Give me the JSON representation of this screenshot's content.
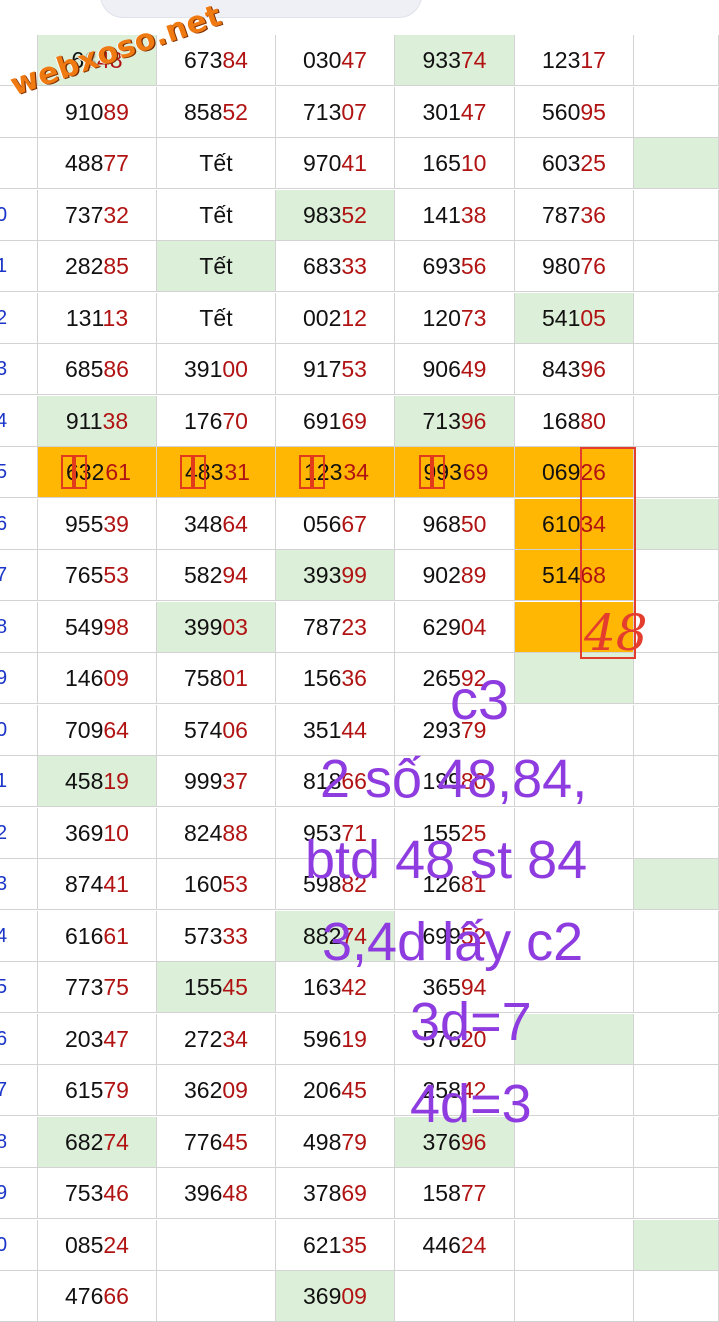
{
  "watermark": "webxoso.net",
  "rows": [
    {
      "label": "",
      "cells": [
        [
          "6",
          "8",
          "48"
        ],
        [
          "673",
          "84"
        ],
        [
          "030",
          "47"
        ],
        [
          "933",
          "74"
        ],
        [
          "123",
          "17"
        ],
        [
          "",
          ""
        ]
      ],
      "green": [
        0,
        3
      ],
      "partial": [
        0
      ]
    },
    {
      "label": "",
      "cells": [
        [
          "910",
          "89"
        ],
        [
          "858",
          "52"
        ],
        [
          "713",
          "07"
        ],
        [
          "301",
          "47"
        ],
        [
          "560",
          "95"
        ],
        [
          "",
          ""
        ]
      ],
      "green": []
    },
    {
      "label": "",
      "cells": [
        [
          "488",
          "77"
        ],
        [
          "Tết",
          ""
        ],
        [
          "970",
          "41"
        ],
        [
          "165",
          "10"
        ],
        [
          "603",
          "25"
        ],
        [
          "",
          ""
        ]
      ],
      "green": [
        5
      ]
    },
    {
      "label": "0",
      "cells": [
        [
          "737",
          "32"
        ],
        [
          "Tết",
          ""
        ],
        [
          "983",
          "52"
        ],
        [
          "141",
          "38"
        ],
        [
          "787",
          "36"
        ],
        [
          "",
          ""
        ]
      ],
      "green": [
        2
      ]
    },
    {
      "label": "1",
      "cells": [
        [
          "282",
          "85"
        ],
        [
          "Tết",
          ""
        ],
        [
          "683",
          "33"
        ],
        [
          "693",
          "56"
        ],
        [
          "980",
          "76"
        ],
        [
          "",
          ""
        ]
      ],
      "green": [
        1
      ]
    },
    {
      "label": "2",
      "cells": [
        [
          "131",
          "13"
        ],
        [
          "Tết",
          ""
        ],
        [
          "002",
          "12"
        ],
        [
          "120",
          "73"
        ],
        [
          "541",
          "05"
        ],
        [
          "",
          ""
        ]
      ],
      "green": [
        4
      ]
    },
    {
      "label": "3",
      "cells": [
        [
          "685",
          "86"
        ],
        [
          "391",
          "00"
        ],
        [
          "917",
          "53"
        ],
        [
          "906",
          "49"
        ],
        [
          "843",
          "96"
        ],
        [
          "",
          ""
        ]
      ],
      "green": []
    },
    {
      "label": "4",
      "cells": [
        [
          "911",
          "38"
        ],
        [
          "176",
          "70"
        ],
        [
          "691",
          "69"
        ],
        [
          "713",
          "96"
        ],
        [
          "168",
          "80"
        ],
        [
          "",
          ""
        ]
      ],
      "green": [
        0,
        3
      ]
    },
    {
      "label": "5",
      "cells": [
        [
          "632",
          "61"
        ],
        [
          "483",
          "31"
        ],
        [
          "123",
          "34"
        ],
        [
          "993",
          "69"
        ],
        [
          "069",
          "26"
        ],
        [
          "",
          ""
        ]
      ],
      "green": [],
      "orange": [
        0,
        1,
        2,
        3,
        4
      ]
    },
    {
      "label": "6",
      "cells": [
        [
          "955",
          "39"
        ],
        [
          "348",
          "64"
        ],
        [
          "056",
          "67"
        ],
        [
          "968",
          "50"
        ],
        [
          "610",
          "34"
        ],
        [
          "",
          ""
        ]
      ],
      "green": [
        5
      ],
      "orange": [
        4
      ]
    },
    {
      "label": "7",
      "cells": [
        [
          "765",
          "53"
        ],
        [
          "582",
          "94"
        ],
        [
          "393",
          "99"
        ],
        [
          "902",
          "89"
        ],
        [
          "514",
          "68"
        ],
        [
          "",
          ""
        ]
      ],
      "green": [
        2
      ],
      "orange": [
        4
      ]
    },
    {
      "label": "8",
      "cells": [
        [
          "549",
          "98"
        ],
        [
          "399",
          "03"
        ],
        [
          "787",
          "23"
        ],
        [
          "629",
          "04"
        ],
        [
          "",
          ""
        ],
        [
          "",
          ""
        ]
      ],
      "green": [
        1
      ],
      "orange": [
        4
      ]
    },
    {
      "label": "9",
      "cells": [
        [
          "146",
          "09"
        ],
        [
          "758",
          "01"
        ],
        [
          "156",
          "36"
        ],
        [
          "265",
          "92"
        ],
        [
          "",
          ""
        ],
        [
          "",
          ""
        ]
      ],
      "green": [
        4
      ]
    },
    {
      "label": "0",
      "cells": [
        [
          "709",
          "64"
        ],
        [
          "574",
          "06"
        ],
        [
          "351",
          "44"
        ],
        [
          "293",
          "79"
        ],
        [
          "",
          ""
        ],
        [
          "",
          ""
        ]
      ],
      "green": []
    },
    {
      "label": "1",
      "cells": [
        [
          "458",
          "19"
        ],
        [
          "999",
          "37"
        ],
        [
          "818",
          "66"
        ],
        [
          "199",
          "80"
        ],
        [
          "",
          ""
        ],
        [
          "",
          ""
        ]
      ],
      "green": [
        0
      ]
    },
    {
      "label": "2",
      "cells": [
        [
          "369",
          "10"
        ],
        [
          "824",
          "88"
        ],
        [
          "953",
          "71"
        ],
        [
          "155",
          "25"
        ],
        [
          "",
          ""
        ],
        [
          "",
          ""
        ]
      ],
      "green": []
    },
    {
      "label": "3",
      "cells": [
        [
          "874",
          "41"
        ],
        [
          "160",
          "53"
        ],
        [
          "598",
          "82"
        ],
        [
          "126",
          "81"
        ],
        [
          "",
          ""
        ],
        [
          "",
          ""
        ]
      ],
      "green": [
        5
      ]
    },
    {
      "label": "4",
      "cells": [
        [
          "616",
          "61"
        ],
        [
          "573",
          "33"
        ],
        [
          "882",
          "74"
        ],
        [
          "699",
          "52"
        ],
        [
          "",
          ""
        ],
        [
          "",
          ""
        ]
      ],
      "green": [
        2
      ]
    },
    {
      "label": "5",
      "cells": [
        [
          "773",
          "75"
        ],
        [
          "155",
          "45"
        ],
        [
          "163",
          "42"
        ],
        [
          "365",
          "94"
        ],
        [
          "",
          ""
        ],
        [
          "",
          ""
        ]
      ],
      "green": [
        1
      ]
    },
    {
      "label": "6",
      "cells": [
        [
          "203",
          "47"
        ],
        [
          "272",
          "34"
        ],
        [
          "596",
          "19"
        ],
        [
          "576",
          "20"
        ],
        [
          "",
          ""
        ],
        [
          "",
          ""
        ]
      ],
      "green": [
        4
      ]
    },
    {
      "label": "7",
      "cells": [
        [
          "615",
          "79"
        ],
        [
          "362",
          "09"
        ],
        [
          "206",
          "45"
        ],
        [
          "258",
          "42"
        ],
        [
          "",
          ""
        ],
        [
          "",
          ""
        ]
      ],
      "green": []
    },
    {
      "label": "8",
      "cells": [
        [
          "682",
          "74"
        ],
        [
          "776",
          "45"
        ],
        [
          "498",
          "79"
        ],
        [
          "376",
          "96"
        ],
        [
          "",
          ""
        ],
        [
          "",
          ""
        ]
      ],
      "green": [
        0,
        3
      ]
    },
    {
      "label": "9",
      "cells": [
        [
          "753",
          "46"
        ],
        [
          "396",
          "48"
        ],
        [
          "378",
          "69"
        ],
        [
          "158",
          "77"
        ],
        [
          "",
          ""
        ],
        [
          "",
          ""
        ]
      ],
      "green": []
    },
    {
      "label": "0",
      "cells": [
        [
          "085",
          "24"
        ],
        [
          "",
          ""
        ],
        [
          "621",
          "35"
        ],
        [
          "446",
          "24"
        ],
        [
          "",
          ""
        ],
        [
          "",
          ""
        ]
      ],
      "green": [
        5
      ]
    },
    {
      "label": "",
      "cells": [
        [
          "476",
          "66"
        ],
        [
          "",
          ""
        ],
        [
          "369",
          "09"
        ],
        [
          "",
          ""
        ],
        [
          "",
          ""
        ],
        [
          "",
          ""
        ]
      ],
      "green": [
        2
      ]
    }
  ],
  "annotation": {
    "hand_48": "48",
    "line1": "c3",
    "line2": "2 số 48,84,",
    "line3": "btd 48 st 84",
    "line4": "3,4d lấy c2",
    "line5": "3d=7",
    "line6": "4d=3"
  }
}
